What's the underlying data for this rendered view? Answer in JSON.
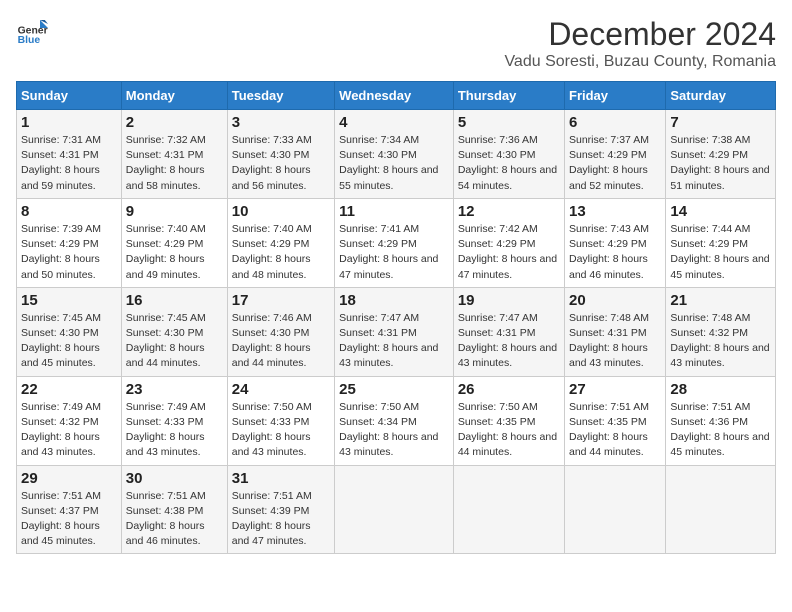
{
  "header": {
    "logo_line1": "General",
    "logo_line2": "Blue",
    "title": "December 2024",
    "subtitle": "Vadu Soresti, Buzau County, Romania"
  },
  "columns": [
    "Sunday",
    "Monday",
    "Tuesday",
    "Wednesday",
    "Thursday",
    "Friday",
    "Saturday"
  ],
  "weeks": [
    [
      {
        "day": "1",
        "sunrise": "7:31 AM",
        "sunset": "4:31 PM",
        "daylight": "8 hours and 59 minutes."
      },
      {
        "day": "2",
        "sunrise": "7:32 AM",
        "sunset": "4:31 PM",
        "daylight": "8 hours and 58 minutes."
      },
      {
        "day": "3",
        "sunrise": "7:33 AM",
        "sunset": "4:30 PM",
        "daylight": "8 hours and 56 minutes."
      },
      {
        "day": "4",
        "sunrise": "7:34 AM",
        "sunset": "4:30 PM",
        "daylight": "8 hours and 55 minutes."
      },
      {
        "day": "5",
        "sunrise": "7:36 AM",
        "sunset": "4:30 PM",
        "daylight": "8 hours and 54 minutes."
      },
      {
        "day": "6",
        "sunrise": "7:37 AM",
        "sunset": "4:29 PM",
        "daylight": "8 hours and 52 minutes."
      },
      {
        "day": "7",
        "sunrise": "7:38 AM",
        "sunset": "4:29 PM",
        "daylight": "8 hours and 51 minutes."
      }
    ],
    [
      {
        "day": "8",
        "sunrise": "7:39 AM",
        "sunset": "4:29 PM",
        "daylight": "8 hours and 50 minutes."
      },
      {
        "day": "9",
        "sunrise": "7:40 AM",
        "sunset": "4:29 PM",
        "daylight": "8 hours and 49 minutes."
      },
      {
        "day": "10",
        "sunrise": "7:40 AM",
        "sunset": "4:29 PM",
        "daylight": "8 hours and 48 minutes."
      },
      {
        "day": "11",
        "sunrise": "7:41 AM",
        "sunset": "4:29 PM",
        "daylight": "8 hours and 47 minutes."
      },
      {
        "day": "12",
        "sunrise": "7:42 AM",
        "sunset": "4:29 PM",
        "daylight": "8 hours and 47 minutes."
      },
      {
        "day": "13",
        "sunrise": "7:43 AM",
        "sunset": "4:29 PM",
        "daylight": "8 hours and 46 minutes."
      },
      {
        "day": "14",
        "sunrise": "7:44 AM",
        "sunset": "4:29 PM",
        "daylight": "8 hours and 45 minutes."
      }
    ],
    [
      {
        "day": "15",
        "sunrise": "7:45 AM",
        "sunset": "4:30 PM",
        "daylight": "8 hours and 45 minutes."
      },
      {
        "day": "16",
        "sunrise": "7:45 AM",
        "sunset": "4:30 PM",
        "daylight": "8 hours and 44 minutes."
      },
      {
        "day": "17",
        "sunrise": "7:46 AM",
        "sunset": "4:30 PM",
        "daylight": "8 hours and 44 minutes."
      },
      {
        "day": "18",
        "sunrise": "7:47 AM",
        "sunset": "4:31 PM",
        "daylight": "8 hours and 43 minutes."
      },
      {
        "day": "19",
        "sunrise": "7:47 AM",
        "sunset": "4:31 PM",
        "daylight": "8 hours and 43 minutes."
      },
      {
        "day": "20",
        "sunrise": "7:48 AM",
        "sunset": "4:31 PM",
        "daylight": "8 hours and 43 minutes."
      },
      {
        "day": "21",
        "sunrise": "7:48 AM",
        "sunset": "4:32 PM",
        "daylight": "8 hours and 43 minutes."
      }
    ],
    [
      {
        "day": "22",
        "sunrise": "7:49 AM",
        "sunset": "4:32 PM",
        "daylight": "8 hours and 43 minutes."
      },
      {
        "day": "23",
        "sunrise": "7:49 AM",
        "sunset": "4:33 PM",
        "daylight": "8 hours and 43 minutes."
      },
      {
        "day": "24",
        "sunrise": "7:50 AM",
        "sunset": "4:33 PM",
        "daylight": "8 hours and 43 minutes."
      },
      {
        "day": "25",
        "sunrise": "7:50 AM",
        "sunset": "4:34 PM",
        "daylight": "8 hours and 43 minutes."
      },
      {
        "day": "26",
        "sunrise": "7:50 AM",
        "sunset": "4:35 PM",
        "daylight": "8 hours and 44 minutes."
      },
      {
        "day": "27",
        "sunrise": "7:51 AM",
        "sunset": "4:35 PM",
        "daylight": "8 hours and 44 minutes."
      },
      {
        "day": "28",
        "sunrise": "7:51 AM",
        "sunset": "4:36 PM",
        "daylight": "8 hours and 45 minutes."
      }
    ],
    [
      {
        "day": "29",
        "sunrise": "7:51 AM",
        "sunset": "4:37 PM",
        "daylight": "8 hours and 45 minutes."
      },
      {
        "day": "30",
        "sunrise": "7:51 AM",
        "sunset": "4:38 PM",
        "daylight": "8 hours and 46 minutes."
      },
      {
        "day": "31",
        "sunrise": "7:51 AM",
        "sunset": "4:39 PM",
        "daylight": "8 hours and 47 minutes."
      },
      null,
      null,
      null,
      null
    ]
  ]
}
